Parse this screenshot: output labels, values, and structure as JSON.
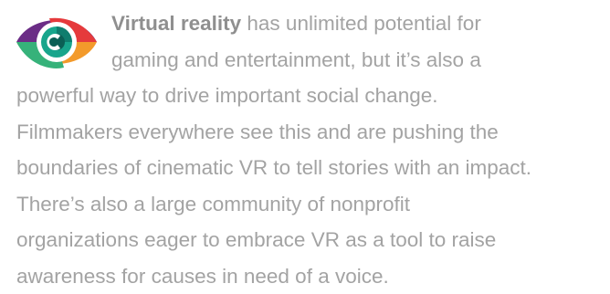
{
  "paragraph": {
    "bold_lead": "Virtual reality",
    "lines": [
      " has unlimited potential for",
      "gaming and entertainment, but it’s also a",
      "powerful way to drive important social change.",
      "Filmmakers everywhere see this and are pushing the",
      "boundaries of cinematic VR to tell stories with an impact.",
      "There’s also a large community of nonprofit",
      "organizations eager to embrace VR as a tool to raise",
      "awareness for causes in need of a voice."
    ]
  },
  "logo": {
    "icon": "eye-icon",
    "colors": {
      "purple": "#6b2d86",
      "red": "#e53a3c",
      "orange": "#f39a2b",
      "green": "#36b27a",
      "teal": "#0f7d6e",
      "iris_center": "#0b5f55"
    }
  },
  "text_color": "#a3a3a3"
}
